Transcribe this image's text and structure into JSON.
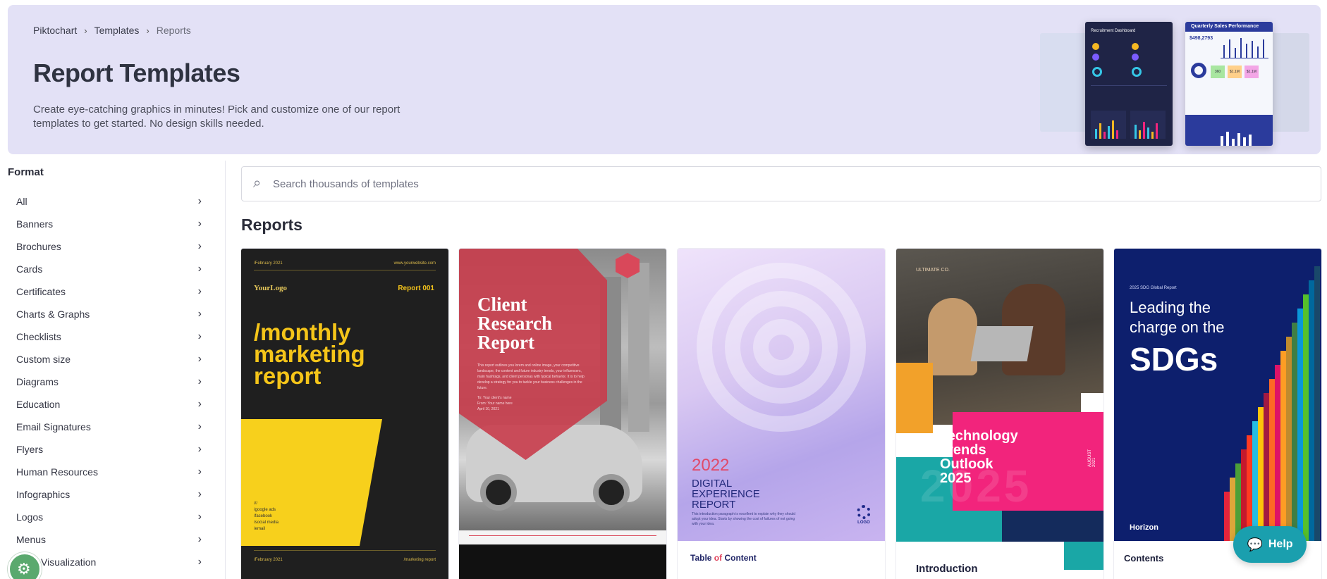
{
  "breadcrumb": {
    "root": "Piktochart",
    "parent": "Templates",
    "current": "Reports"
  },
  "hero": {
    "title": "Report Templates",
    "description": "Create eye-catching graphics in minutes! Pick and customize one of our report templates to get started. No design skills needed.",
    "art": {
      "dark_card_title": "Recruitment Dashboard",
      "light_card_title": "Quarterly Sales Performance",
      "light_card_value": "$498,2793",
      "stat1": "360",
      "stat2": "$1.1M",
      "stat3": "$1.1M"
    }
  },
  "sidebar": {
    "heading": "Format",
    "items": [
      {
        "label": "All"
      },
      {
        "label": "Banners"
      },
      {
        "label": "Brochures"
      },
      {
        "label": "Cards"
      },
      {
        "label": "Certificates"
      },
      {
        "label": "Charts & Graphs"
      },
      {
        "label": "Checklists"
      },
      {
        "label": "Custom size"
      },
      {
        "label": "Diagrams"
      },
      {
        "label": "Education"
      },
      {
        "label": "Email Signatures"
      },
      {
        "label": "Flyers"
      },
      {
        "label": "Human Resources"
      },
      {
        "label": "Infographics"
      },
      {
        "label": "Logos"
      },
      {
        "label": "Menus"
      },
      {
        "label": "Visualization"
      }
    ]
  },
  "search": {
    "placeholder": "Search thousands of templates",
    "value": ""
  },
  "section_title": "Reports",
  "cards": {
    "c1": {
      "date_top": "/February 2021",
      "site": "www.yourwebsite.com",
      "logo": "YourLogo",
      "report_no": "Report 001",
      "title_1": "/monthly",
      "title_2": "marketing",
      "title_3": "report",
      "links": [
        "///",
        "/google ads",
        "/facebook",
        "/social media",
        "/email"
      ],
      "date_bottom": "/February 2021",
      "footer_right": "/marketing report"
    },
    "c2": {
      "title_1": "Client",
      "title_2": "Research",
      "title_3": "Report",
      "body": "This report outlines you lorem and online image, your competitive landscape, the content and future industry trends, your influencers, main hashtags, and client personas with typical behavior. It is to help develop a strategy for you to tackle your business challenges in the future.",
      "prepared": "To: Your client's name",
      "from": "From: Your name here",
      "date": "April 10, 2021"
    },
    "c3": {
      "year": "2022",
      "title_1": "DIGITAL",
      "title_2": "EXPERIENCE",
      "title_3": "REPORT",
      "small": "This introduction paragraph is excellent to explain why they should adopt your idea. Starts by showing the cost of failures of not going with your idea.",
      "logo": "LOGO",
      "toc_a": "Table ",
      "toc_b": "of",
      "toc_c": " Content"
    },
    "c4": {
      "brand": "ULTIMATE CO.",
      "title_1": "Technology",
      "title_2": "Trends",
      "title_3": "Outlook",
      "title_4": "2025",
      "big": "2025",
      "date": "AUGUST 2021",
      "intro": "Introduction"
    },
    "c5": {
      "tag": "2025 SDG Global Report",
      "title_1": "Leading the",
      "title_2": "charge on the",
      "sdg": "SDGs",
      "brand": "Horizon",
      "contents": "Contents"
    }
  },
  "help": {
    "label": "Help"
  },
  "colors": {
    "hero_bg": "#e3e1f6",
    "help": "#1a9fae",
    "accent_yellow": "#f5c519",
    "accent_pink": "#f2247c",
    "navy": "#0d1f6d"
  }
}
